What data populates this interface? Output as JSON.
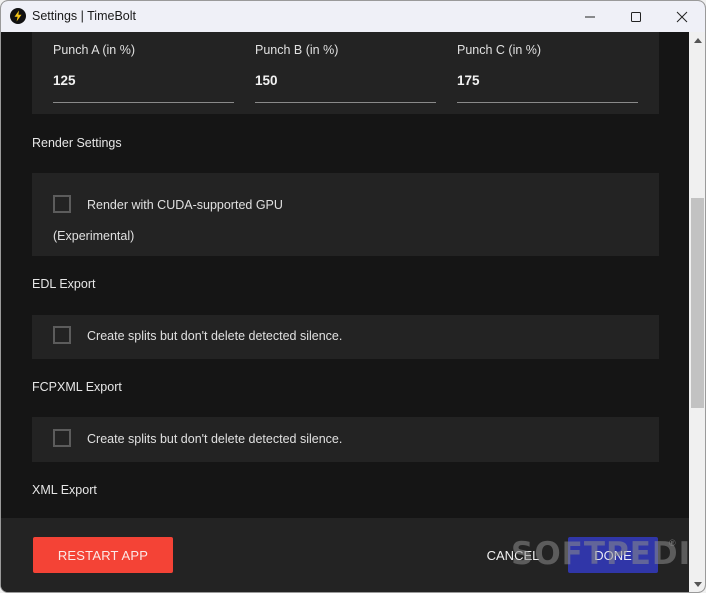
{
  "window": {
    "title": "Settings | TimeBolt",
    "app_icon": "lightning-bolt-icon",
    "controls": {
      "minimize": "minimize-icon",
      "maximize": "maximize-icon",
      "close": "close-icon"
    }
  },
  "punch": {
    "fields": [
      {
        "label": "Punch A (in %)",
        "value": "125"
      },
      {
        "label": "Punch B (in %)",
        "value": "150"
      },
      {
        "label": "Punch C (in %)",
        "value": "175"
      }
    ]
  },
  "render_settings": {
    "heading": "Render Settings",
    "cuda_label": "Render with CUDA-supported GPU",
    "cuda_note": "(Experimental)",
    "cuda_checked": false
  },
  "edl_export": {
    "heading": "EDL Export",
    "option_label": "Create splits but don't delete detected silence.",
    "checked": false
  },
  "fcpxml_export": {
    "heading": "FCPXML Export",
    "option_label": "Create splits but don't delete detected silence.",
    "checked": false
  },
  "xml_export": {
    "heading": "XML Export"
  },
  "footer": {
    "restart_label": "RESTART APP",
    "cancel_label": "CANCEL",
    "done_label": "DONE",
    "watermark": "SOFTPEDIA",
    "watermark_mark": "®"
  },
  "colors": {
    "restart": "#f44336",
    "done": "#3036a8",
    "background": "#151515",
    "card": "#232323"
  }
}
